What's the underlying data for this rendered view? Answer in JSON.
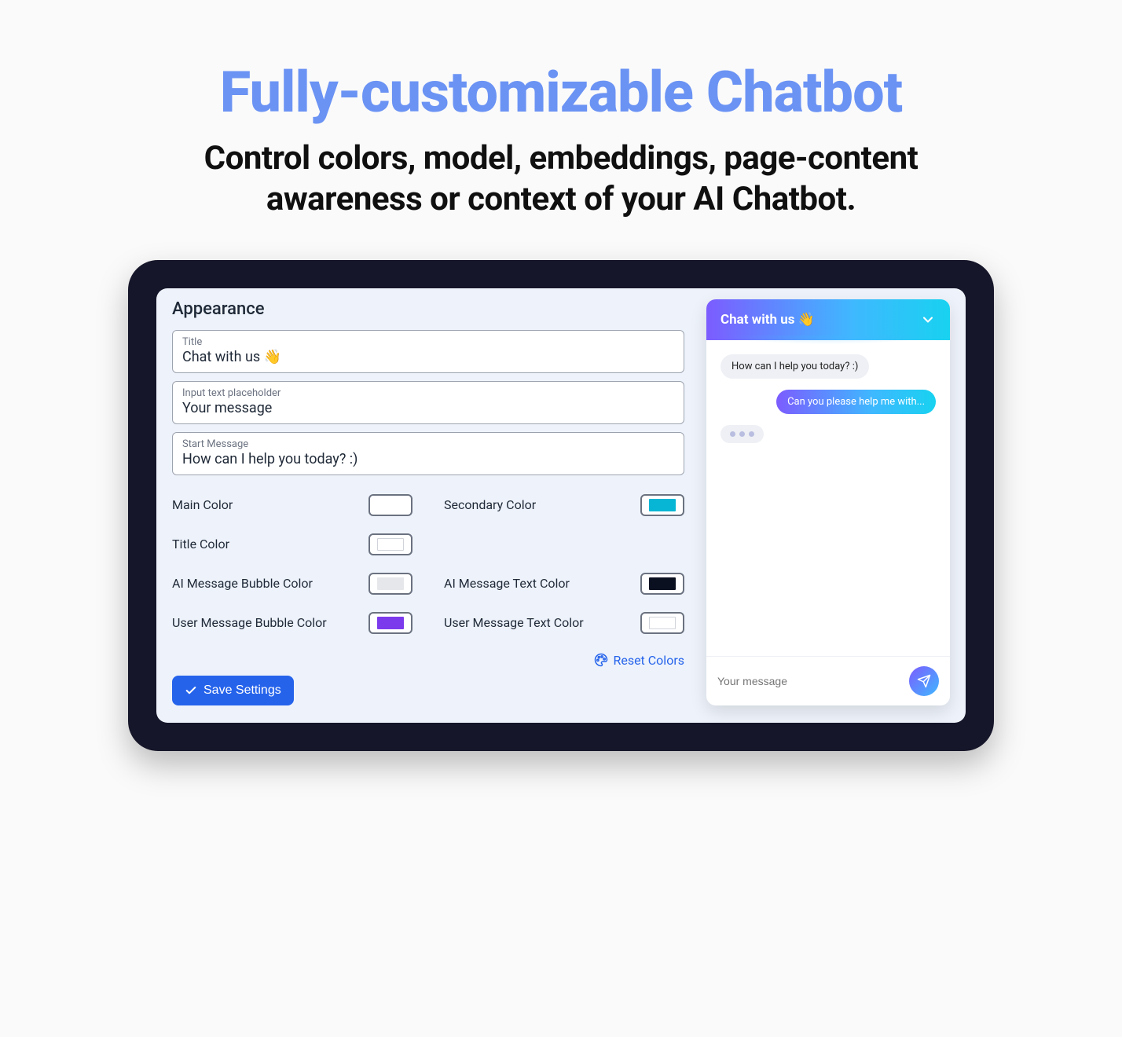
{
  "hero": {
    "title": "Fully-customizable Chatbot",
    "subtitle": "Control colors, model, embeddings, page-content awareness or context of your AI Chatbot."
  },
  "appearance": {
    "section_title": "Appearance",
    "fields": {
      "title": {
        "label": "Title",
        "value": "Chat with us 👋"
      },
      "placeholder": {
        "label": "Input text placeholder",
        "value": "Your message"
      },
      "start_message": {
        "label": "Start Message",
        "value": "How can I help you today? :)"
      }
    },
    "colors": {
      "main": {
        "label": "Main Color",
        "value": "#7c3aed"
      },
      "secondary": {
        "label": "Secondary Color",
        "value": "#06b6d4"
      },
      "title": {
        "label": "Title Color",
        "value": "#ffffff"
      },
      "ai_bubble": {
        "label": "AI Message Bubble Color",
        "value": "#e5e7eb"
      },
      "ai_text": {
        "label": "AI Message Text Color",
        "value": "#0b1020"
      },
      "user_bubble": {
        "label": "User Message Bubble Color",
        "value": "#7c3aed"
      },
      "user_text": {
        "label": "User Message Text Color",
        "value": "#ffffff"
      }
    },
    "reset_label": "Reset Colors",
    "save_label": "Save Settings"
  },
  "chat": {
    "header_title": "Chat with us 👋",
    "ai_message": "How can I help you today? :)",
    "user_message": "Can you please help me with...",
    "input_placeholder": "Your message"
  }
}
